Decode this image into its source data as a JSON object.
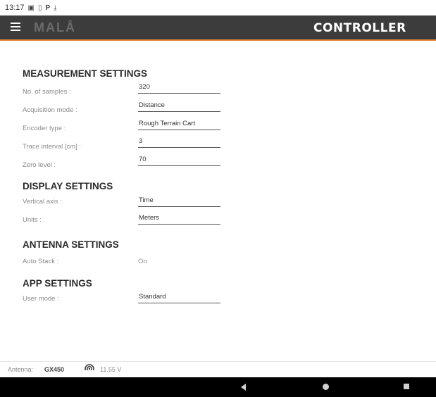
{
  "status_bar": {
    "time": "13:17",
    "icons": [
      "image-icon",
      "sim-icon",
      "p-icon",
      "download-icon"
    ]
  },
  "app_bar": {
    "logo": "MALÅ",
    "title": "CONTROLLER",
    "accent_color": "#e8893a",
    "background_color": "#3c3c3c"
  },
  "measurement": {
    "title": "MEASUREMENT SETTINGS",
    "samples": {
      "label": "No. of samples :",
      "value": "320"
    },
    "acq_mode": {
      "label": "Acquisition mode :",
      "value": "Distance"
    },
    "encoder": {
      "label": "Encoder type :",
      "value": "Rough Terrain Cart"
    },
    "trace": {
      "label": "Trace interval [cm] :",
      "value": "3"
    },
    "zero": {
      "label": "Zero level :",
      "value": "70"
    }
  },
  "display": {
    "title": "DISPLAY SETTINGS",
    "vaxis": {
      "label": "Vertical axis :",
      "value": "Time"
    },
    "units": {
      "label": "Units :",
      "value": "Meters"
    }
  },
  "antenna": {
    "title": "ANTENNA SETTINGS",
    "autostack": {
      "label": "Auto Stack :",
      "value": "On"
    }
  },
  "app": {
    "title": "APP SETTINGS",
    "usermode": {
      "label": "User mode :",
      "value": "Standard"
    }
  },
  "footer": {
    "antenna_label": "Antenna:",
    "antenna_value": "GX450",
    "voltage": "11.55 V"
  }
}
